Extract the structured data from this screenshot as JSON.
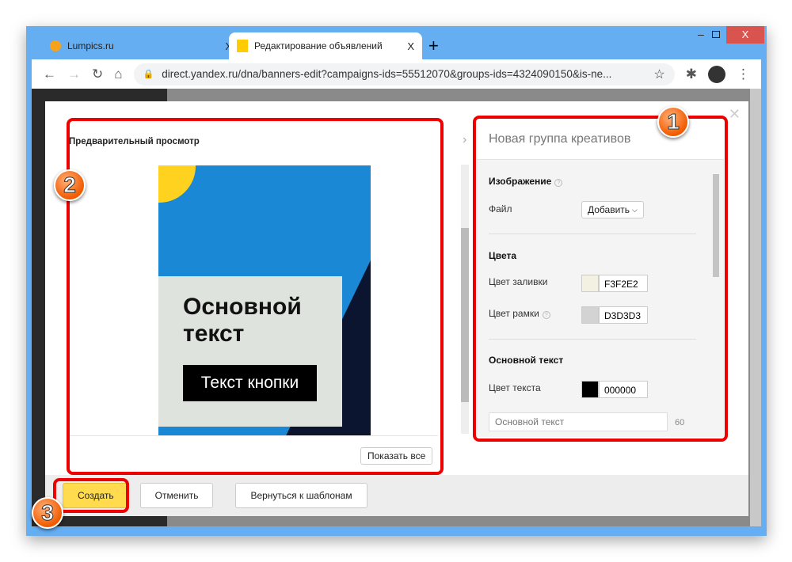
{
  "browser": {
    "tabs": [
      {
        "title": "Lumpics.ru",
        "close": "X"
      },
      {
        "title": "Редактирование объявлений",
        "close": "X"
      }
    ],
    "new_tab": "+",
    "url": "direct.yandex.ru/dna/banners-edit?campaigns-ids=55512070&groups-ids=4324090150&is-ne..."
  },
  "preview": {
    "title": "Предварительный просмотр",
    "banner_text": "Основной текст",
    "banner_button": "Текст кнопки",
    "show_all": "Показать все"
  },
  "panel": {
    "title": "Новая группа креативов",
    "image_section": "Изображение",
    "file_label": "Файл",
    "add_button": "Добавить",
    "colors_section": "Цвета",
    "fill_label": "Цвет заливки",
    "fill_value": "F3F2E2",
    "border_label": "Цвет рамки",
    "border_value": "D3D3D3",
    "text_section": "Основной текст",
    "text_color_label": "Цвет текста",
    "text_color_value": "000000",
    "text_placeholder": "Основной текст",
    "text_limit": "60"
  },
  "footer": {
    "create": "Создать",
    "cancel": "Отменить",
    "back": "Вернуться к шаблонам"
  },
  "badges": [
    "1",
    "2",
    "3"
  ],
  "colors": {
    "highlight": "#ee0000",
    "accent": "#ffdb4d",
    "banner_blue": "#1a88d4"
  }
}
